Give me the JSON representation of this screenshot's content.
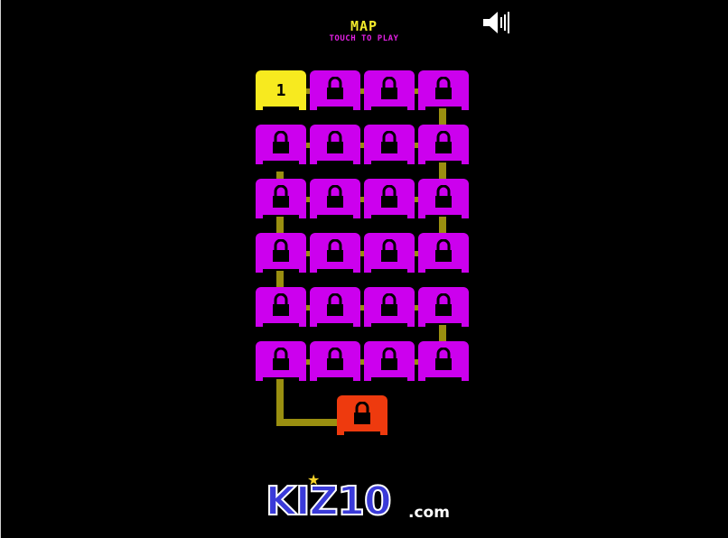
{
  "header": {
    "title": "MAP",
    "subtitle": "TOUCH TO PLAY"
  },
  "sound_button": {
    "icon": "speaker-icon",
    "state": "on"
  },
  "level_grid": {
    "rows": 6,
    "cols": 4,
    "unlocked_level": "1",
    "levels": [
      {
        "label": "1",
        "state": "unlocked"
      },
      {
        "state": "locked"
      },
      {
        "state": "locked"
      },
      {
        "state": "locked"
      },
      {
        "state": "locked"
      },
      {
        "state": "locked"
      },
      {
        "state": "locked"
      },
      {
        "state": "locked"
      },
      {
        "state": "locked"
      },
      {
        "state": "locked"
      },
      {
        "state": "locked"
      },
      {
        "state": "locked"
      },
      {
        "state": "locked"
      },
      {
        "state": "locked"
      },
      {
        "state": "locked"
      },
      {
        "state": "locked"
      },
      {
        "state": "locked"
      },
      {
        "state": "locked"
      },
      {
        "state": "locked"
      },
      {
        "state": "locked"
      },
      {
        "state": "locked"
      },
      {
        "state": "locked"
      },
      {
        "state": "locked"
      },
      {
        "state": "locked"
      }
    ],
    "final_level": {
      "state": "locked"
    }
  },
  "colors": {
    "background": "#000000",
    "title": "#f2ea2b",
    "subtitle": "#e020e0",
    "locked_tile": "#cc00ee",
    "unlocked_tile": "#f7ea1f",
    "final_tile": "#ee3a0e",
    "path": "#9a8f10"
  },
  "branding": {
    "logo_text": "KIZ10",
    "logo_suffix": ".com"
  }
}
